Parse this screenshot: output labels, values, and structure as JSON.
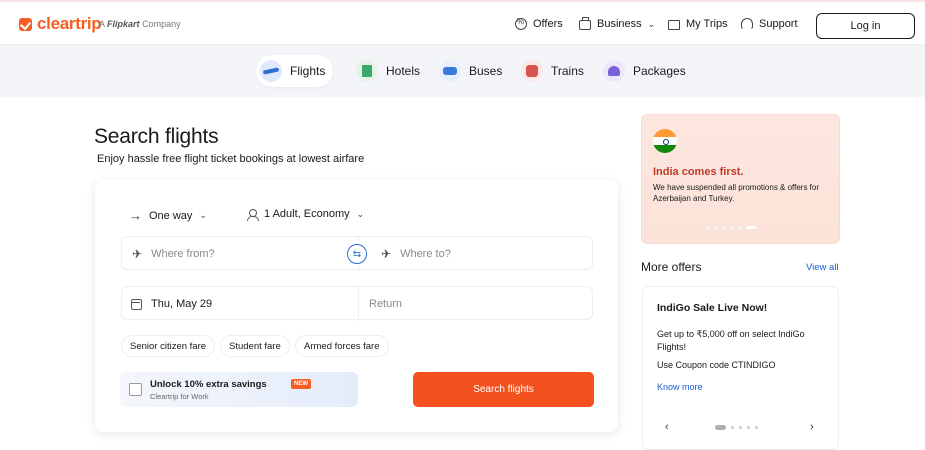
{
  "header": {
    "logo": "cleartrip",
    "tagline_prefix": "A",
    "tagline_brand": "Flipkart",
    "tagline_suffix": "Company",
    "nav": {
      "offers": "Offers",
      "business": "Business",
      "my_trips": "My Trips",
      "support": "Support"
    },
    "login": "Log in"
  },
  "tabs": [
    {
      "label": "Flights",
      "icon": "flight-icon",
      "active": true
    },
    {
      "label": "Hotels",
      "icon": "hotel-icon",
      "active": false
    },
    {
      "label": "Buses",
      "icon": "bus-icon",
      "active": false
    },
    {
      "label": "Trains",
      "icon": "train-icon",
      "active": false
    },
    {
      "label": "Packages",
      "icon": "package-icon",
      "active": false
    }
  ],
  "search": {
    "title": "Search flights",
    "subtitle": "Enjoy hassle free flight ticket bookings at lowest airfare",
    "trip_type": "One way",
    "travellers": "1 Adult, Economy",
    "from_placeholder": "Where from?",
    "to_placeholder": "Where to?",
    "depart_date": "Thu, May 29",
    "return_placeholder": "Return",
    "fare_chips": [
      "Senior citizen fare",
      "Student fare",
      "Armed forces fare"
    ],
    "unlock": {
      "title": "Unlock 10% extra savings",
      "badge": "NEW",
      "subtitle": "Cleartrip for Work"
    },
    "search_button": "Search flights"
  },
  "promo": {
    "title": "India comes first.",
    "text": "We have suspended all promotions & offers for Azerbaijan and Turkey."
  },
  "offers": {
    "heading": "More offers",
    "view_all": "View all",
    "card": {
      "title": "IndiGo Sale Live Now!",
      "description": "Get up to ₹5,000 off on select IndiGo Flights!",
      "coupon": "Use Coupon code CTINDIGO",
      "link": "Know more"
    }
  },
  "colors": {
    "brand": "#f55f23",
    "cta": "#f4511e",
    "link": "#1a5bd6",
    "promo_title": "#c0392b"
  }
}
